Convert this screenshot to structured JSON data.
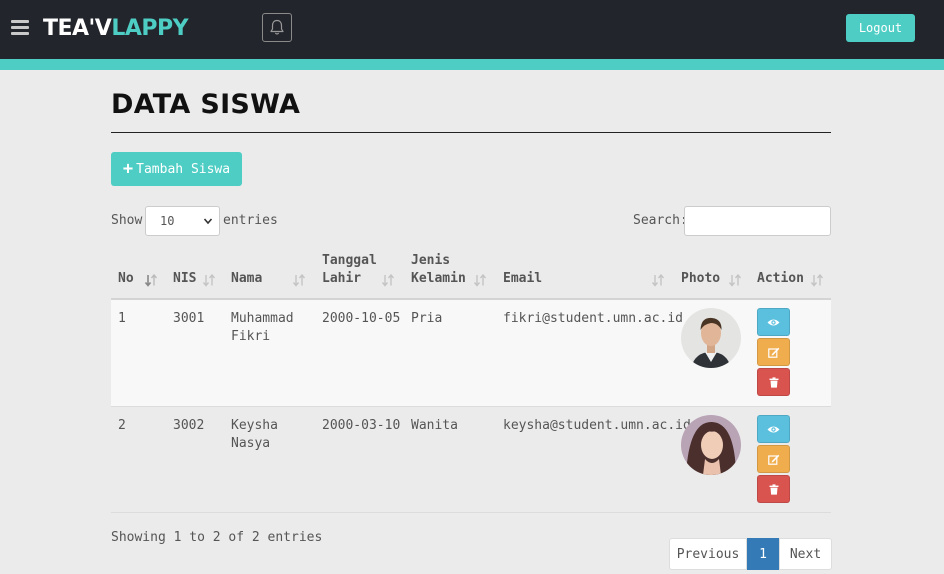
{
  "navbar": {
    "brand_part1": "TEA'V",
    "brand_part2": "LAPPY",
    "logout_label": "Logout",
    "accent_color": "#4ecdc4",
    "icons": [
      "hamburger-icon",
      "bell-icon"
    ]
  },
  "page": {
    "title": "DATA SISWA",
    "add_button_label": "Tambah Siswa"
  },
  "controls": {
    "show_label": "Show",
    "entries_value": "10",
    "entries_label": "entries",
    "search_label": "Search:",
    "search_value": ""
  },
  "table": {
    "headers": [
      "No",
      "NIS",
      "Nama",
      "Tanggal Lahir",
      "Jenis Kelamin",
      "Email",
      "Photo",
      "Action"
    ],
    "rows": [
      {
        "no": "1",
        "nis": "3001",
        "nama": "Muhammad Fikri",
        "tanggal_lahir": "2000-10-05",
        "jenis_kelamin": "Pria",
        "email": "fikri@student.umn.ac.id"
      },
      {
        "no": "2",
        "nis": "3002",
        "nama": "Keysha Nasya",
        "tanggal_lahir": "2000-03-10",
        "jenis_kelamin": "Wanita",
        "email": "keysha@student.umn.ac.id"
      }
    ],
    "action_icons": [
      "eye-icon",
      "edit-icon",
      "trash-icon"
    ]
  },
  "footer": {
    "info": "Showing 1 to 2 of 2 entries",
    "prev_label": "Previous",
    "current_page": "1",
    "next_label": "Next"
  },
  "colors": {
    "navbar_bg": "#22252b",
    "accent": "#4ecdc4",
    "view_button": "#5bc0de",
    "edit_button": "#f0ad4e",
    "delete_button": "#d9534f",
    "active_page": "#337ab7"
  }
}
